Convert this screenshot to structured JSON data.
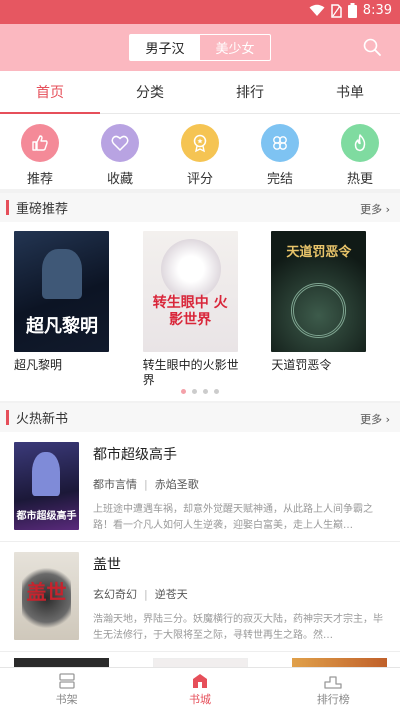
{
  "status": {
    "time": "8:39"
  },
  "header": {
    "gender_male": "男子汉",
    "gender_female": "美少女"
  },
  "tabs": [
    "首页",
    "分类",
    "排行",
    "书单"
  ],
  "quick": [
    {
      "label": "推荐",
      "icon": "thumb-up-icon",
      "color": "#f48a98"
    },
    {
      "label": "收藏",
      "icon": "heart-icon",
      "color": "#b8a3e2"
    },
    {
      "label": "评分",
      "icon": "medal-icon",
      "color": "#f5c453"
    },
    {
      "label": "完结",
      "icon": "clover-icon",
      "color": "#7ec3f2"
    },
    {
      "label": "热更",
      "icon": "flame-icon",
      "color": "#7fdba0"
    }
  ],
  "featured": {
    "title": "重磅推荐",
    "more": "更多",
    "books": [
      {
        "title": "超凡黎明",
        "cover_text": "超凡黎明"
      },
      {
        "title": "转生眼中的火影世界",
        "cover_text": "转生眼中 火影世界"
      },
      {
        "title": "天道罚恶令",
        "cover_text": "天道罚恶令"
      }
    ]
  },
  "new_books": {
    "title": "火热新书",
    "more": "更多",
    "items": [
      {
        "title": "都市超级高手",
        "genre": "都市言情",
        "author": "赤焰圣歌",
        "desc": "上班途中遭遇车祸，却意外觉醒天赋神通，从此路上人间争霸之路！看一介凡人如何人生逆袭，迎娶白富美，走上人生巅…",
        "cover_text": "都市超级高手"
      },
      {
        "title": "盖世",
        "genre": "玄幻奇幻",
        "author": "逆苍天",
        "desc": "浩瀚天地，界陆三分。妖魔横行的寂灭大陆，药神宗天才宗主，毕生无法修行，于大限将至之际，寻转世再生之路。然…",
        "cover_text": "盖世"
      }
    ]
  },
  "bottom_nav": [
    {
      "label": "书架",
      "icon": "bookshelf-icon"
    },
    {
      "label": "书城",
      "icon": "store-icon"
    },
    {
      "label": "排行榜",
      "icon": "podium-icon"
    }
  ],
  "colors": {
    "accent": "#e64f5a",
    "header_bg": "#fbb8c0",
    "status_bg": "#e65761"
  }
}
